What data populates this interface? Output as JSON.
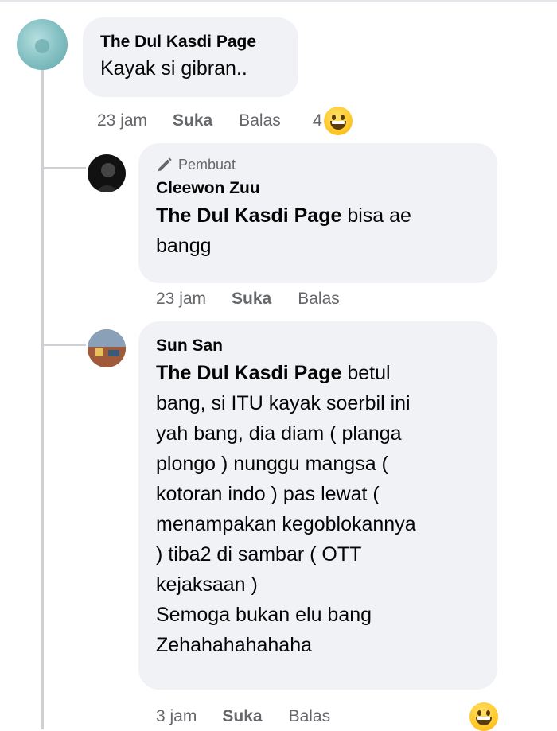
{
  "comments": [
    {
      "author": "The Dul Kasdi Page",
      "text": "Kayak si gibran..",
      "time": "23 jam",
      "like": "Suka",
      "reply": "Balas",
      "reaction_count": "4",
      "reaction_icon": "laugh-emoji-icon"
    },
    {
      "badge": "Pembuat",
      "author": "Cleewon Zuu",
      "mention": "The Dul Kasdi Page",
      "text": " bisa ae\nbangg",
      "time": "23 jam",
      "like": "Suka",
      "reply": "Balas"
    },
    {
      "author": "Sun San",
      "mention": "The Dul Kasdi Page",
      "text": " betul\nbang, si ITU kayak soerbil ini\nyah bang, dia diam ( planga\nplongo ) nunggu mangsa (\nkotoran indo ) pas lewat (\nmenampakan kegoblokannya\n) tiba2 di sambar ( OTT\nkejaksaan )\nSemoga bukan elu bang\nZehahahahahaha",
      "time": "3 jam",
      "like": "Suka",
      "reply": "Balas",
      "reaction_icon": "laugh-emoji-icon"
    }
  ],
  "colors": {
    "bubble": "#f0f2f5",
    "meta_text": "#65676b",
    "thread_line": "#ced0d4"
  }
}
